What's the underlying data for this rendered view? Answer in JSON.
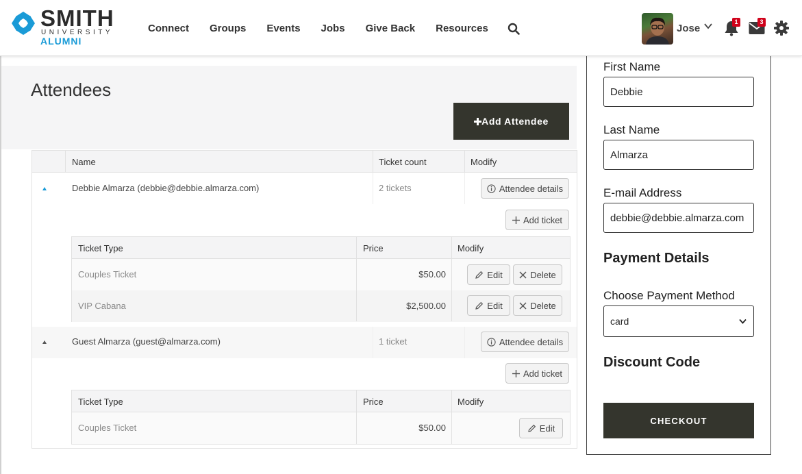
{
  "brand": {
    "name": "SMITH",
    "sub": "UNIVERSITY",
    "alumni": "ALUMNI"
  },
  "nav": [
    "Connect",
    "Groups",
    "Events",
    "Jobs",
    "Give Back",
    "Resources"
  ],
  "user": {
    "name": "Jose",
    "notifications": "1",
    "messages": "3"
  },
  "attendees": {
    "title": "Attendees",
    "add_button": "Add Attendee",
    "columns": [
      "Name",
      "Ticket count",
      "Modify"
    ],
    "ticket_columns": [
      "Ticket Type",
      "Price",
      "Modify"
    ],
    "details_label": "Attendee details",
    "add_ticket_label": "Add ticket",
    "edit_label": "Edit",
    "delete_label": "Delete",
    "list": [
      {
        "name": "Debbie Almarza (debbie@debbie.almarza.com)",
        "count": "2 tickets",
        "tickets": [
          {
            "type": "Couples Ticket",
            "price": "$50.00"
          },
          {
            "type": "VIP Cabana",
            "price": "$2,500.00"
          }
        ]
      },
      {
        "name": "Guest Almarza (guest@almarza.com)",
        "count": "1 ticket",
        "tickets": [
          {
            "type": "Couples Ticket",
            "price": "$50.00"
          }
        ]
      }
    ]
  },
  "form": {
    "first_name_label": "First Name",
    "first_name": "Debbie",
    "last_name_label": "Last Name",
    "last_name": "Almarza",
    "email_label": "E-mail Address",
    "email": "debbie@debbie.almarza.com",
    "payment_title": "Payment Details",
    "method_label": "Choose Payment Method",
    "method": "card",
    "discount_title": "Discount Code",
    "checkout": "CHECKOUT"
  },
  "colors": {
    "accent": "#1a9bd7",
    "dark_button": "#34352d",
    "badge": "#d0021b"
  }
}
